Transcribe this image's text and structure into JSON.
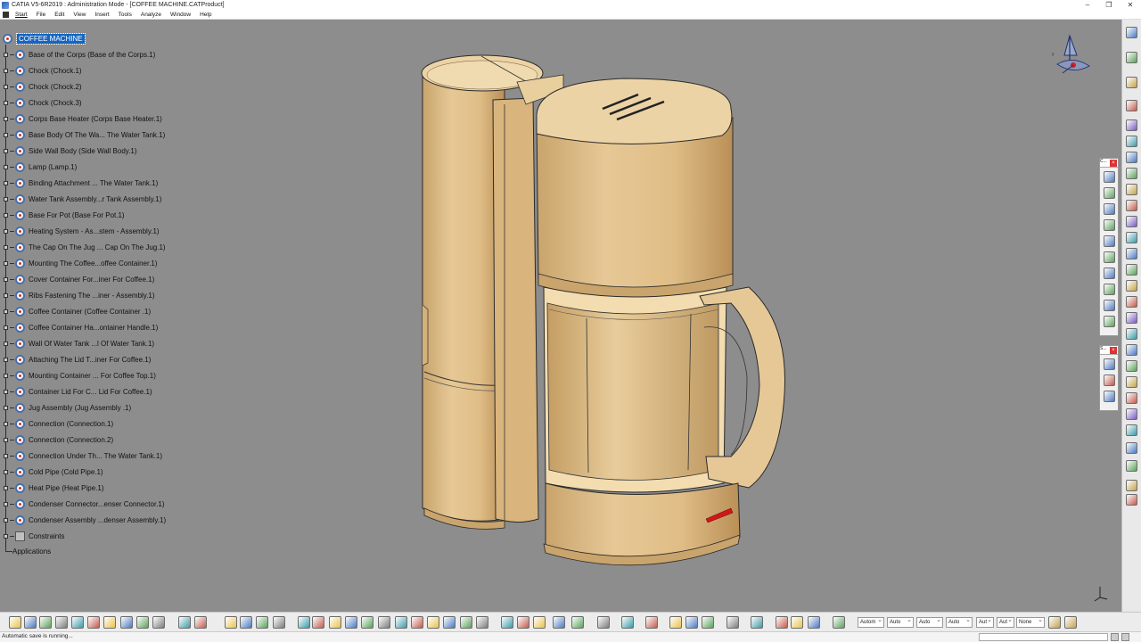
{
  "window": {
    "title": "CATIA V5-6R2019 : Administration Mode - [COFFEE MACHINE.CATProduct]",
    "controls": [
      "–",
      "❐",
      "✕"
    ]
  },
  "menu": {
    "items": [
      "Start",
      "File",
      "Edit",
      "View",
      "Insert",
      "Tools",
      "Analyze",
      "Window",
      "Help"
    ]
  },
  "tree": {
    "root": "COFFEE MACHINE",
    "nodes": [
      "Base of the Corps (Base of the Corps.1)",
      "Chock (Chock.1)",
      "Chock (Chock.2)",
      "Chock (Chock.3)",
      "Corps Base Heater (Corps Base Heater.1)",
      "Base Body Of The Wa... The Water Tank.1)",
      "Side Wall Body (Side Wall Body.1)",
      "Lamp (Lamp.1)",
      "Binding Attachment ... The Water Tank.1)",
      "Water Tank Assembly...r Tank Assembly.1)",
      "Base For Pot (Base For Pot.1)",
      "Heating System - As...stem - Assembly.1)",
      "The Cap On The Jug ... Cap On The Jug.1)",
      "Mounting The Coffee...offee Container.1)",
      "Cover Container For...iner For Coffee.1)",
      "Ribs Fastening The ...iner - Assembly.1)",
      "Coffee Container  (Coffee Container .1)",
      "Coffee Container Ha...ontainer Handle.1)",
      "Wall Of Water Tank ...l Of Water Tank.1)",
      "Attaching The Lid T...iner For Coffee.1)",
      "Mounting Container ... For Coffee Top.1)",
      "Container Lid For C... Lid For Coffee.1)",
      "Jug Assembly  (Jug Assembly .1)",
      "Connection (Connection.1)",
      "Connection (Connection.2)",
      "Connection Under Th... The Water Tank.1)",
      "Cold Pipe (Cold Pipe.1)",
      "Heat Pipe (Heat Pipe.1)",
      "Condenser Connector...enser Connector.1)",
      "Condenser Assembly ...denser Assembly.1)",
      "Constraints"
    ],
    "applications": "Applications"
  },
  "floating_toolbars": [
    {
      "head": "C..."
    },
    {
      "head": "S..."
    }
  ],
  "bottom_combos": [
    "Autom",
    "Auto",
    "Auto",
    "Auto",
    "Aut",
    "Aut",
    "None"
  ],
  "status": {
    "text": "Automatic save is running..."
  },
  "colors": {
    "viewport_bg": "#8d8d8d",
    "model_body": "#e2c08a",
    "model_shadow": "#c9a46c",
    "selection": "#1565c0",
    "lamp": "#d01818"
  }
}
